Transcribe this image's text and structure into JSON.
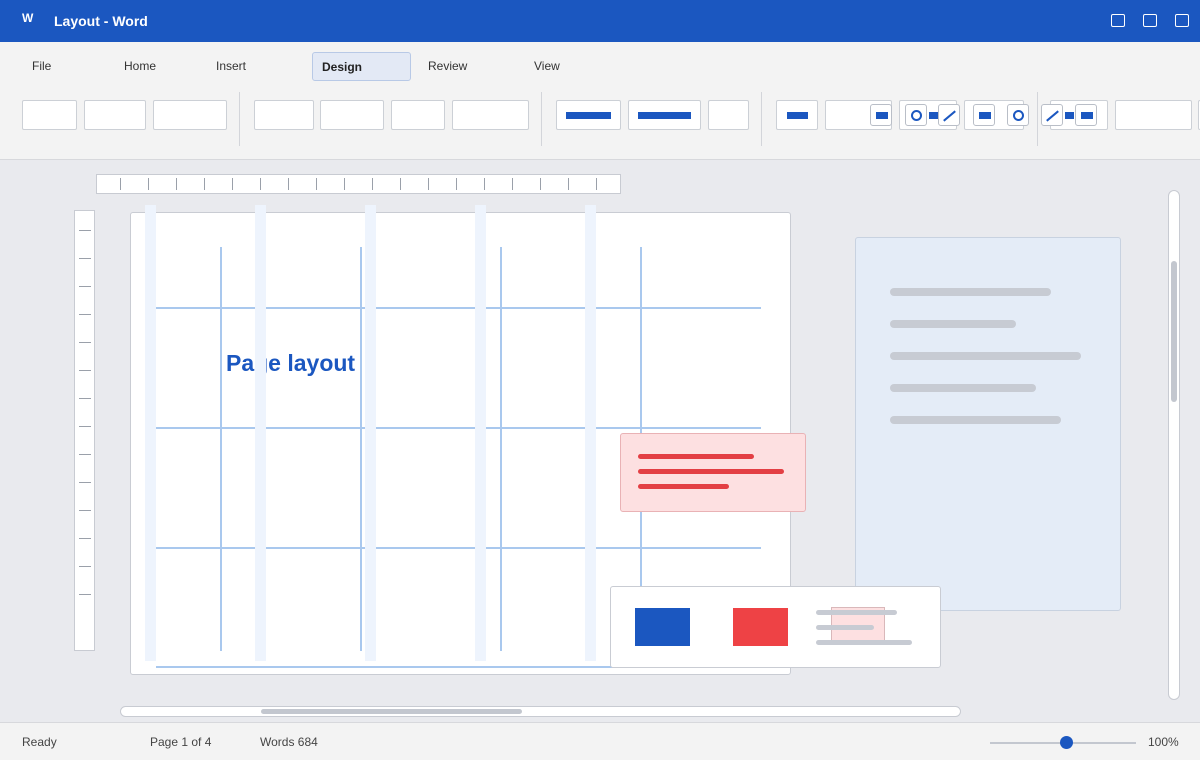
{
  "window": {
    "app_icon": "W",
    "title": "Layout - Word"
  },
  "ribbon": {
    "tabs": [
      {
        "label": "File"
      },
      {
        "label": "Home"
      },
      {
        "label": "Insert"
      },
      {
        "label": "Design",
        "active": true
      },
      {
        "label": "Review"
      },
      {
        "label": "View"
      }
    ]
  },
  "document": {
    "heading": "Page layout"
  },
  "status": {
    "state": "Ready",
    "page": "Page 1 of 4",
    "words": "Words 684",
    "zoom": "100%",
    "zoom_slider_fraction": 0.52
  },
  "colors": {
    "accent": "#1b57c0",
    "red": "#e33f44",
    "pink": "#fde0e1",
    "panel_blue": "#e4ecf7"
  }
}
